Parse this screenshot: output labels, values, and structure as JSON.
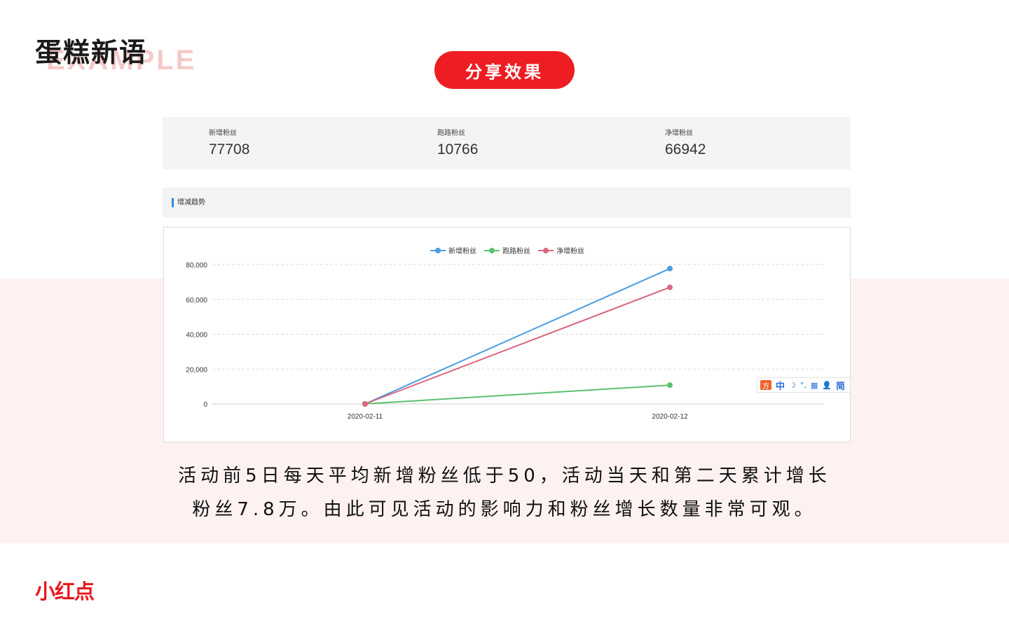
{
  "brand": {
    "title": "蛋糕新语",
    "watermark": "EXAMPLE"
  },
  "section_pill": "分享效果",
  "stats": [
    {
      "label": "新增粉丝",
      "value": "77708"
    },
    {
      "label": "跑路粉丝",
      "value": "10766"
    },
    {
      "label": "净增粉丝",
      "value": "66942"
    }
  ],
  "trend": {
    "title": "增减趋势"
  },
  "chart_data": {
    "type": "line",
    "categories": [
      "2020-02-11",
      "2020-02-12"
    ],
    "series": [
      {
        "name": "新增粉丝",
        "color": "#4a9de0",
        "values": [
          0,
          77708
        ]
      },
      {
        "name": "跑路粉丝",
        "color": "#5cc16e",
        "values": [
          0,
          10766
        ]
      },
      {
        "name": "净增粉丝",
        "color": "#d9687e",
        "values": [
          0,
          66942
        ]
      }
    ],
    "ylim": [
      0,
      80000
    ],
    "yticks": [
      0,
      20000,
      40000,
      60000,
      80000
    ],
    "ytick_labels": [
      "0",
      "20,000",
      "40,000",
      "60,000",
      "80,000"
    ],
    "grid": true,
    "legend": "top-center"
  },
  "ime": {
    "logo": "方",
    "mode": "中",
    "moon": "☽",
    "punct": "°,",
    "keyboard": "▦",
    "user": "👤",
    "variant": "简"
  },
  "description": {
    "line1": "活动前5日每天平均新增粉丝低于50，活动当天和第二天累计增长",
    "line2": "粉丝7.8万。由此可见活动的影响力和粉丝增长数量非常可观。"
  },
  "footer_logo": "小红点"
}
